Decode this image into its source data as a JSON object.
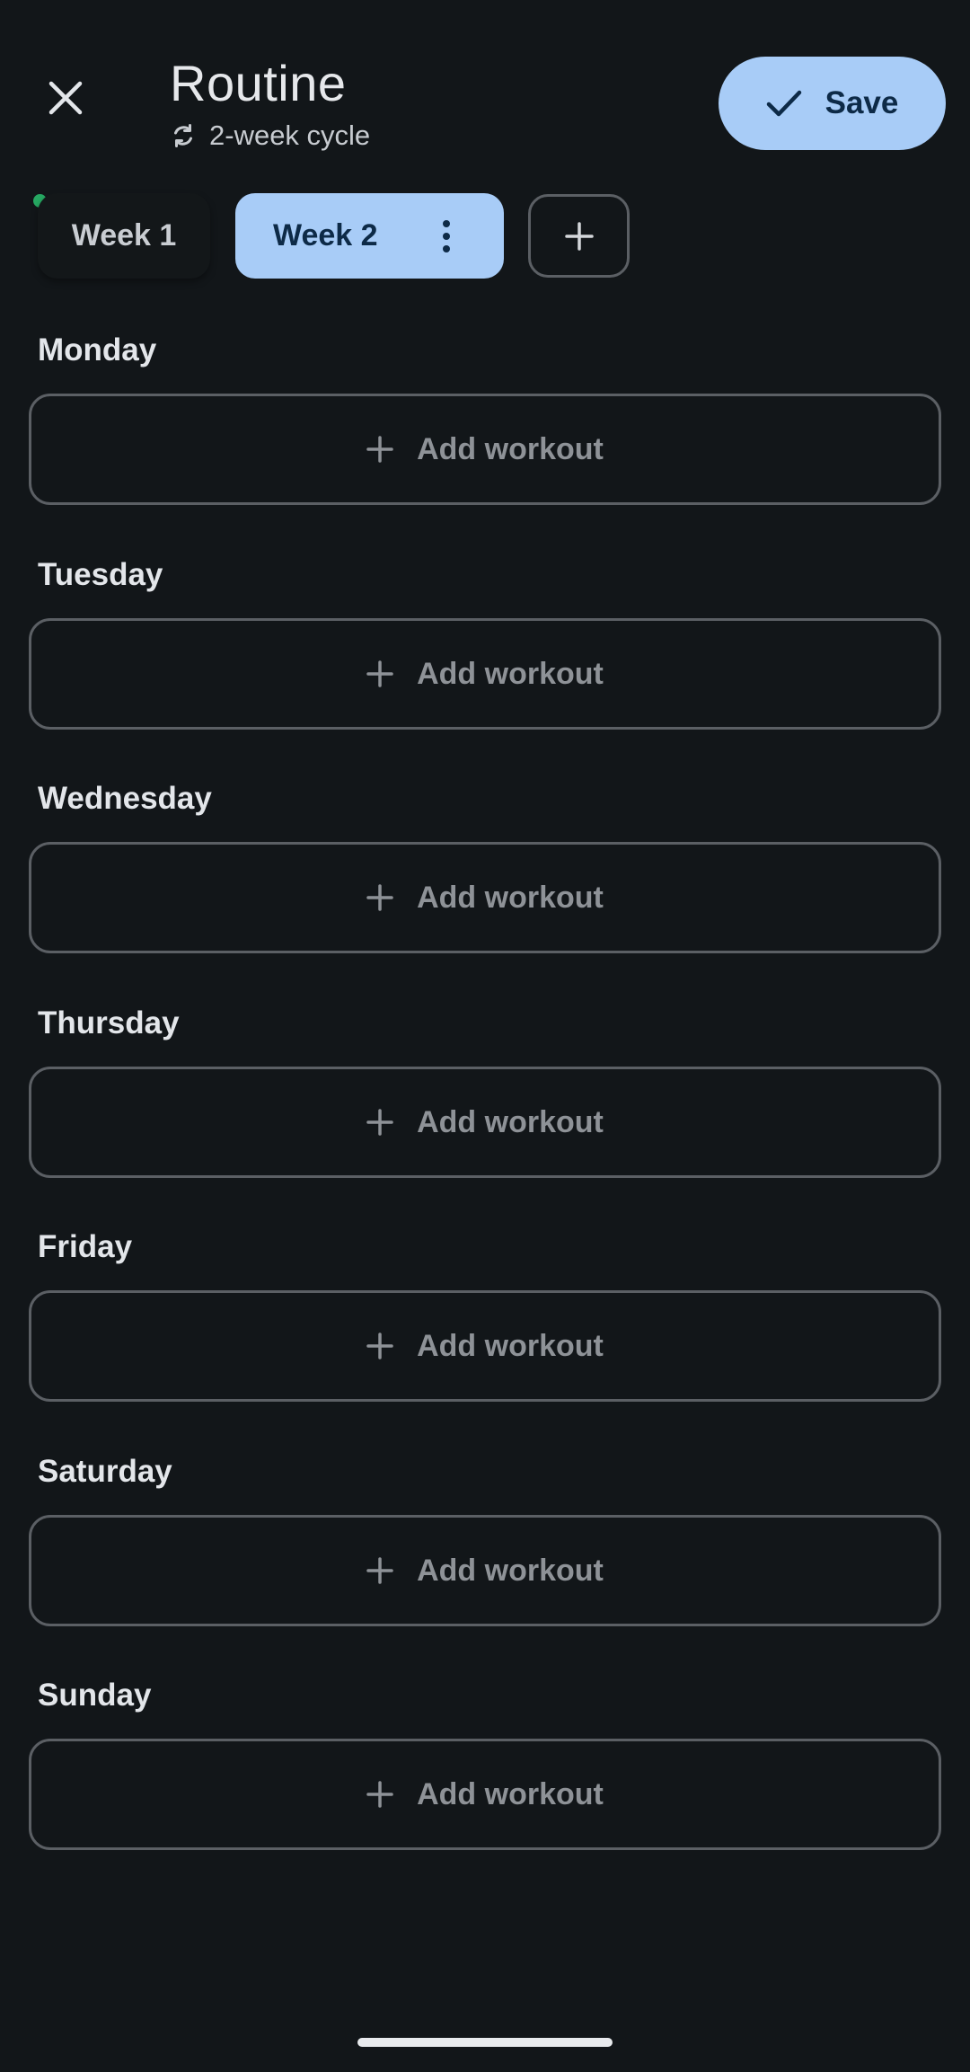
{
  "header": {
    "title": "Routine",
    "subtitle": "2-week cycle",
    "save_label": "Save"
  },
  "weeks": {
    "tabs": [
      {
        "label": "Week 1",
        "selected": false,
        "active_indicator": true
      },
      {
        "label": "Week 2",
        "selected": true
      }
    ]
  },
  "days": [
    {
      "label": "Monday",
      "action": "Add workout"
    },
    {
      "label": "Tuesday",
      "action": "Add workout"
    },
    {
      "label": "Wednesday",
      "action": "Add workout"
    },
    {
      "label": "Thursday",
      "action": "Add workout"
    },
    {
      "label": "Friday",
      "action": "Add workout"
    },
    {
      "label": "Saturday",
      "action": "Add workout"
    },
    {
      "label": "Sunday",
      "action": "Add workout"
    }
  ],
  "colors": {
    "background": "#121619",
    "accent": "#a8ccf7",
    "accent_text": "#0d2a47",
    "indicator": "#26a862",
    "outline": "#5b5f64"
  },
  "icons": {
    "close": "close-icon",
    "cycle": "cycle-icon",
    "save": "check-icon",
    "menu": "more-vert-icon",
    "add": "plus-icon"
  }
}
